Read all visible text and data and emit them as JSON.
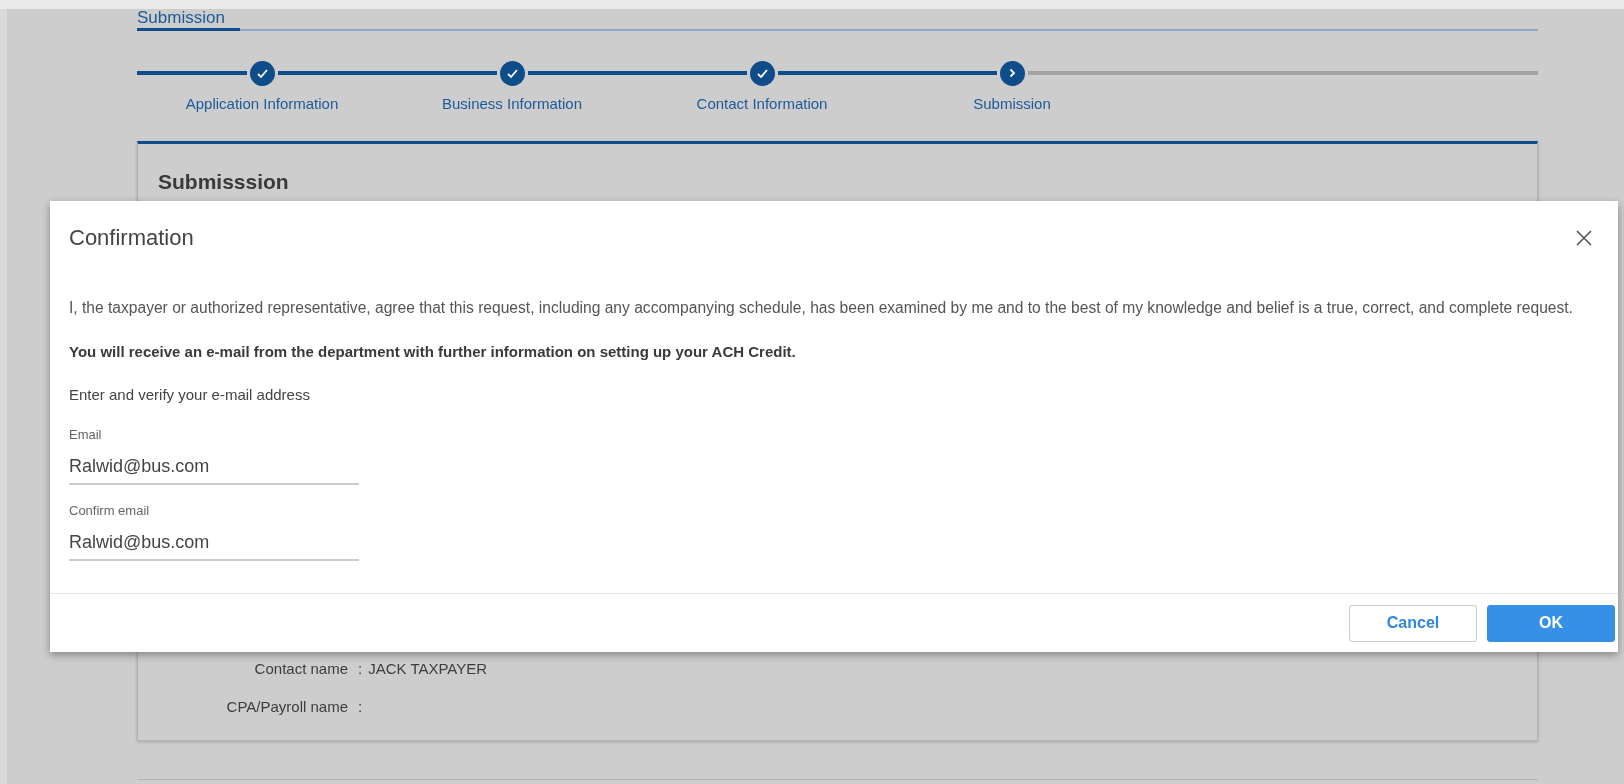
{
  "tab": {
    "label": "Submission",
    "selected": true
  },
  "steps": [
    {
      "label": "Application Information",
      "kind": "done"
    },
    {
      "label": "Business Information",
      "kind": "done"
    },
    {
      "label": "Contact Information",
      "kind": "done"
    },
    {
      "label": "Submission",
      "kind": "current"
    }
  ],
  "section": {
    "title": "Submisssion",
    "fields": [
      {
        "label": "Contact name",
        "separator": ":",
        "value": "JACK TAXPAYER"
      },
      {
        "label": "CPA/Payroll name",
        "separator": ":"
      }
    ]
  },
  "dialog": {
    "title": "Confirmation",
    "statement": "I, the taxpayer or authorized representative, agree that this request, including any accompanying schedule, has been examined by me and to the best of my knowledge and belief is a true, correct, and complete request.",
    "notice": "You will receive an e-mail from the department with further information on setting up your ACH Credit.",
    "prompt": "Enter and verify your e-mail address",
    "fields": [
      {
        "label": "Email",
        "value": "Ralwid@bus.com"
      },
      {
        "label": "Confirm email",
        "value": "Ralwid@bus.com"
      }
    ],
    "buttons": [
      {
        "label": "Cancel",
        "kind": "secondary"
      },
      {
        "label": "OK",
        "kind": "primary"
      }
    ]
  }
}
